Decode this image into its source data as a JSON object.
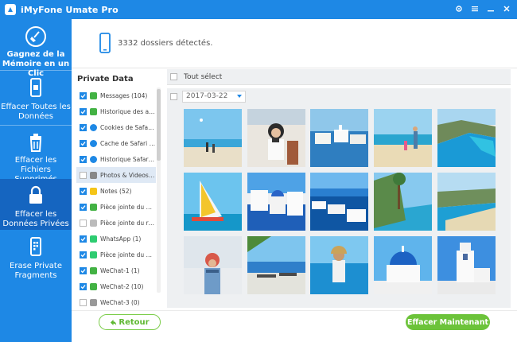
{
  "app": {
    "title": "iMyFone Umate Pro"
  },
  "sidebar": {
    "items": [
      {
        "label": "Gagnez de la Mémoire en un Clic",
        "icon": "broom-icon"
      },
      {
        "label": "Effacer Toutes les Données",
        "icon": "phone-erase-icon"
      },
      {
        "label": "Effacer les Fichiers Supprimés",
        "icon": "trash-icon"
      },
      {
        "label": "Effacer les Données Privées",
        "icon": "lock-icon"
      },
      {
        "label": "Erase Private Fragments",
        "icon": "phone-fragments-icon"
      }
    ]
  },
  "header": {
    "count_text": "3332 dossiers détectés."
  },
  "list": {
    "title": "Private Data",
    "items": [
      {
        "label": "Messages (104)",
        "checked": true,
        "icon_color": "#43b244"
      },
      {
        "label": "Historique des ap...",
        "checked": true,
        "icon_color": "#43b244"
      },
      {
        "label": "Cookies de Safari ...",
        "checked": true,
        "icon_color": "#1e88e5"
      },
      {
        "label": "Cache de Safari (1...",
        "checked": true,
        "icon_color": "#1e88e5"
      },
      {
        "label": "Historique Safari (...",
        "checked": true,
        "icon_color": "#1e88e5"
      },
      {
        "label": "Photos & Videos (...",
        "checked": false,
        "icon_color": "#888888",
        "selected": true
      },
      {
        "label": "Notes (52)",
        "checked": true,
        "icon_color": "#f5c518"
      },
      {
        "label": "Pièce jointe du me...",
        "checked": true,
        "icon_color": "#43b244"
      },
      {
        "label": "Pièce jointe du re...",
        "checked": false,
        "icon_color": "#bbbbbb"
      },
      {
        "label": "WhatsApp (1)",
        "checked": true,
        "icon_color": "#2ecc71"
      },
      {
        "label": "Pièce jointe du W...",
        "checked": true,
        "icon_color": "#2ecc71"
      },
      {
        "label": "WeChat-1 (1)",
        "checked": true,
        "icon_color": "#43b244"
      },
      {
        "label": "WeChat-2 (10)",
        "checked": true,
        "icon_color": "#43b244"
      },
      {
        "label": "WeChat-3 (0)",
        "checked": false,
        "icon_color": "#999999"
      }
    ]
  },
  "grid": {
    "select_all_label": "Tout sélect",
    "date_value": "2017-03-22"
  },
  "footer": {
    "back_label": "Retour",
    "erase_label": "Effacer Maintenant"
  },
  "colors": {
    "brand": "#1e88e5",
    "brand_dark": "#1565c0",
    "accent_green": "#6cc33a"
  }
}
